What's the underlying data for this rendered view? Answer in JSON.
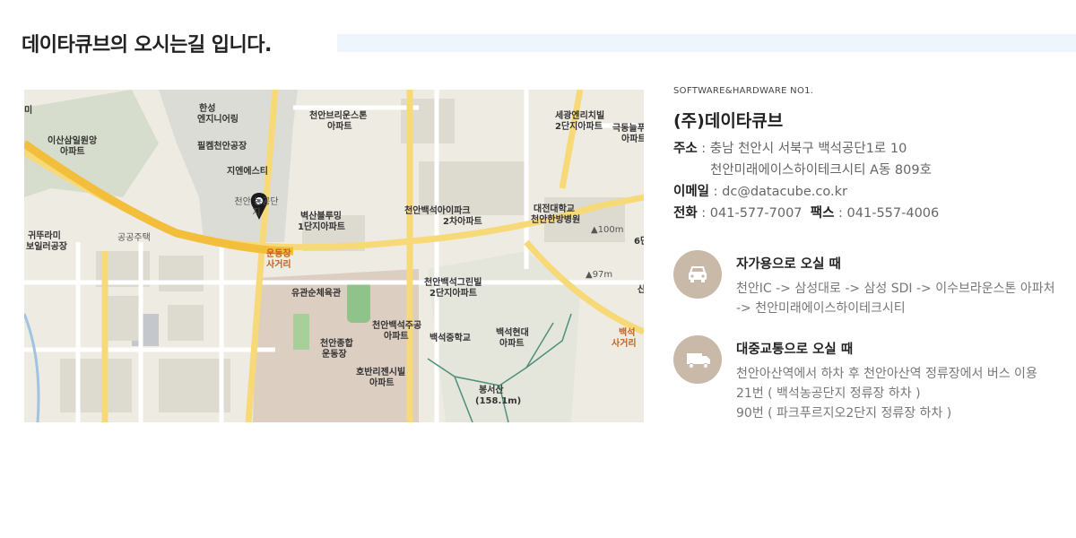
{
  "page": {
    "title": "데이타큐브의 오시는길 입니다."
  },
  "map": {
    "labels": [
      "한성",
      "엔지니어링",
      "천안브리운스톤",
      "아파트",
      "세광엔리치빌",
      "2단지아파트",
      "극동늘푸른",
      "아파트",
      "이산삼일원앙",
      "아파트",
      "필켐천안공장",
      "지엔에스티",
      "천안 농공단지",
      "벽산블루밍",
      "1단지아파트",
      "천안백석아이파크",
      "2차아파트",
      "대전대학교",
      "천안한방병원",
      "▲100m",
      "귀뚜라미",
      "보일러공장",
      "공공주택",
      "운동장",
      "사거리",
      "유관순체육관",
      "천안백석그린빌",
      "2단지아파트",
      "천안백석주공",
      "아파트",
      "백석중학교",
      "백석현대",
      "아파트",
      "천안종합",
      "운동장",
      "호반리젠시빌",
      "아파트",
      "봉서산",
      "(158.1m)",
      "▲97m",
      "백석",
      "사거리",
      "6단",
      "미",
      "산"
    ]
  },
  "info": {
    "tagline": "SOFTWARE&HARDWARE NO1.",
    "company": "(주)데이타큐브",
    "address_label": "주소",
    "address_line1": "충남 천안시 서북구 백석공단1로 10",
    "address_line2": "천안미래에이스하이테크시티 A동 809호",
    "email_label": "이메일",
    "email": "dc@datacube.co.kr",
    "phone_label": "전화",
    "phone": "041-577-7007",
    "fax_label": "팩스",
    "fax": "041-557-4006",
    "separator": " : "
  },
  "directions": {
    "car": {
      "icon": "car-icon",
      "title": "자가용으로 오실 때",
      "lines": [
        "천안IC -> 삼성대로 -> 삼성 SDI -> 이수브라운스톤 아파처",
        "-> 천안미래에이스하이테크시티"
      ]
    },
    "bus": {
      "icon": "bus-icon",
      "title": "대중교통으로 오실 때",
      "lines": [
        "천안아산역에서 하차 후 천안아산역 정류장에서 버스 이용",
        "21번 ( 백석농공단지 정류장 하차 )",
        "90번 ( 파크푸르지오2단지 정류장 하차 )"
      ]
    },
    "accent_color": "#c8b9a8"
  }
}
